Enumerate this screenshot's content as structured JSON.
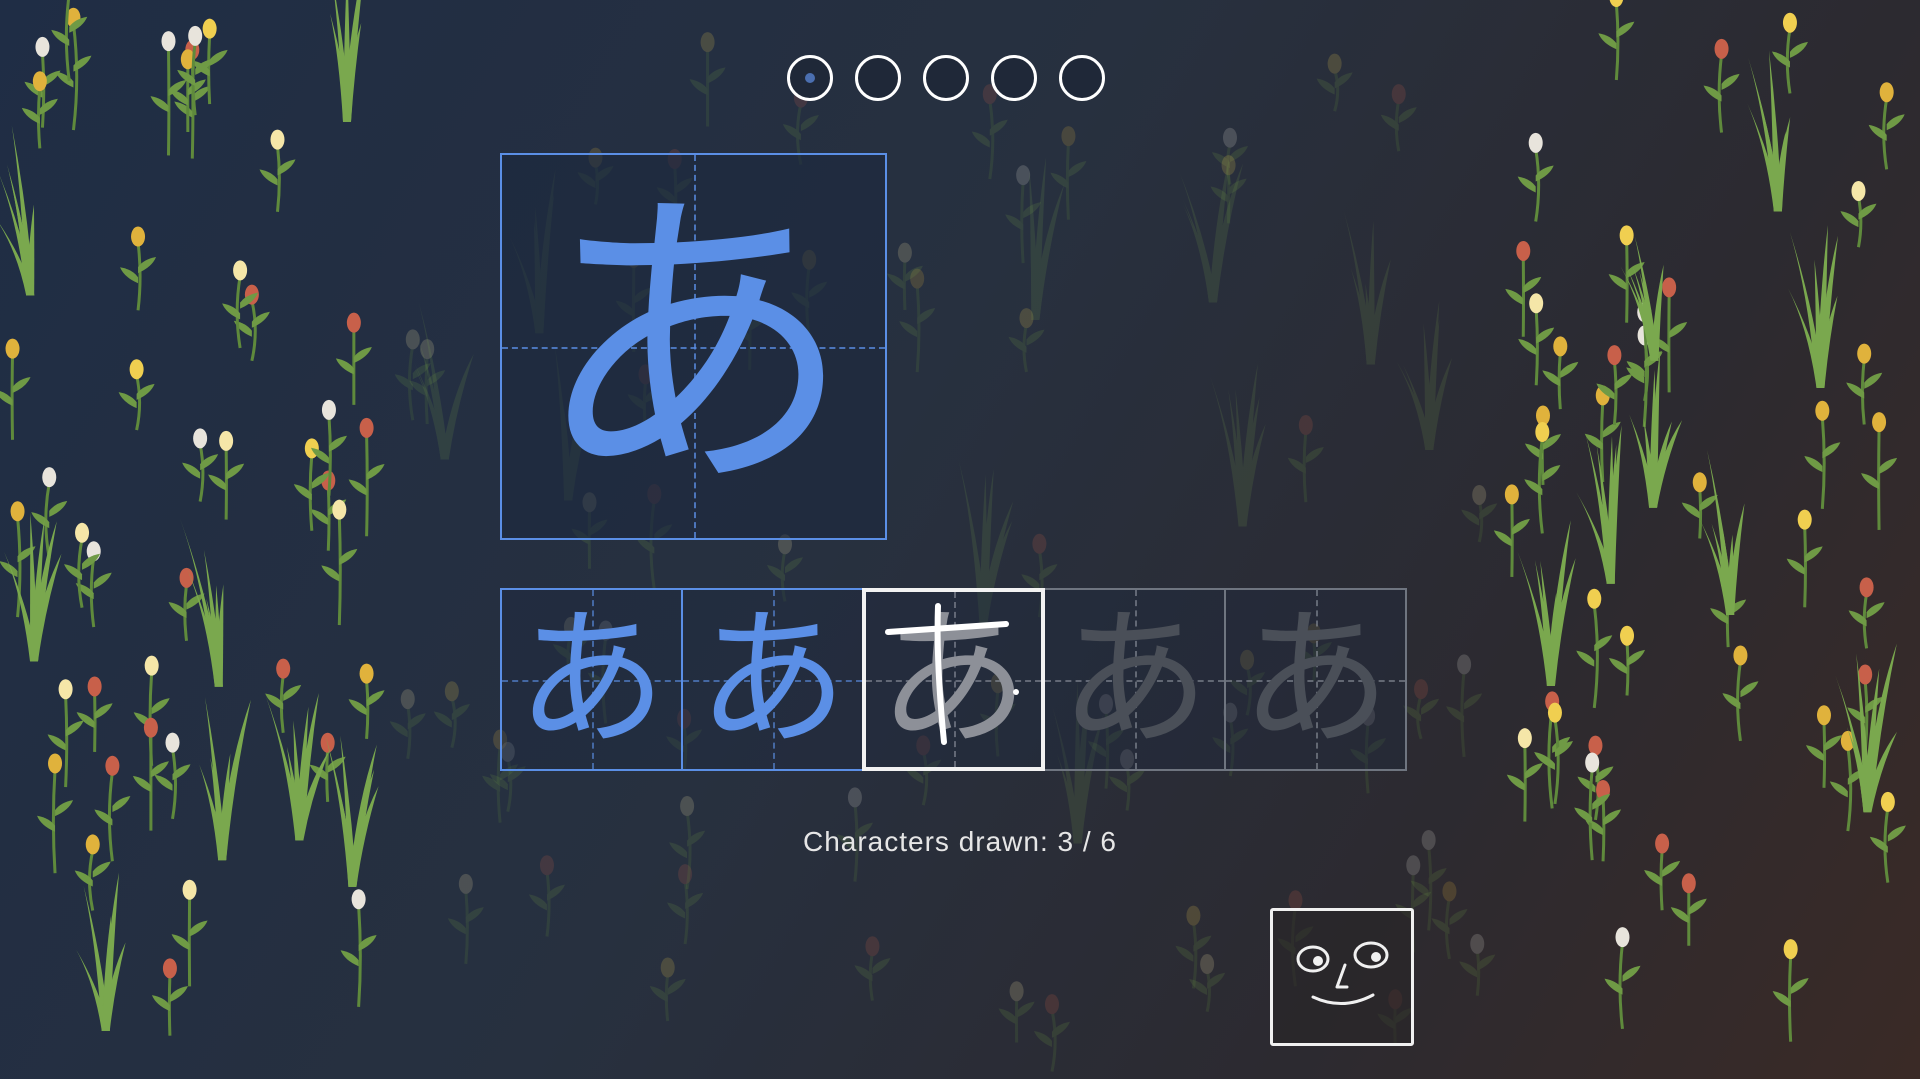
{
  "progress": {
    "total_steps": 5,
    "current_step": 1
  },
  "lesson": {
    "character": "あ",
    "stroke_color": "#5b8fe6"
  },
  "practice": {
    "cells": [
      {
        "char": "あ",
        "state": "done"
      },
      {
        "char": "あ",
        "state": "done"
      },
      {
        "char": "あ",
        "state": "current"
      },
      {
        "char": "あ",
        "state": "empty"
      },
      {
        "char": "あ",
        "state": "empty"
      }
    ]
  },
  "status": {
    "text": "Characters drawn: 3 / 6"
  },
  "helper": {
    "icon": "face-icon"
  },
  "theme": {
    "accent": "#5b8fe6",
    "current_border": "#f2f2f2",
    "empty_border": "#6f7580"
  }
}
